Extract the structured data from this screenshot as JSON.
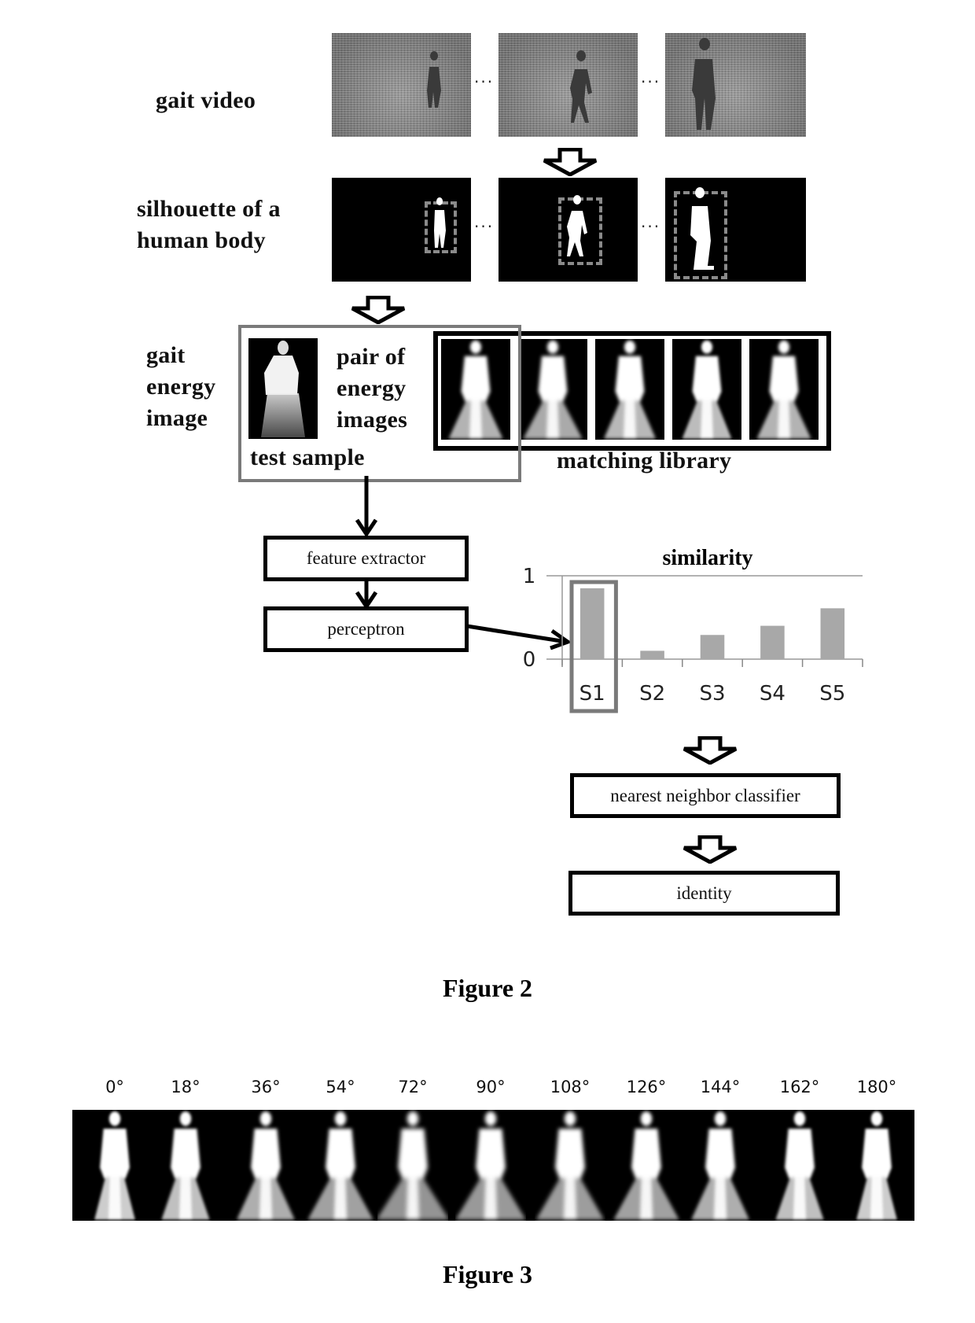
{
  "figure2": {
    "caption": "Figure 2",
    "labels": {
      "gait_video": "gait video",
      "silhouette_line1": "silhouette of a",
      "silhouette_line2": "human body",
      "gei_line1": "gait",
      "gei_line2": "energy",
      "gei_line3": "image",
      "pair_line1": "pair of",
      "pair_line2": "energy",
      "pair_line3": "images",
      "test_sample": "test sample",
      "matching_library": "matching library"
    },
    "ellipsis": "···",
    "gait_video_frames": 3,
    "silhouette_frames": 3,
    "matching_library_count": 5,
    "flow": {
      "feature_extractor": "feature extractor",
      "perceptron": "perceptron",
      "nearest_neighbor": "nearest neighbor classifier",
      "identity": "identity"
    },
    "highlight_color": "#7a7a7a",
    "bar_color": "#a8a8a8"
  },
  "chart_data": {
    "type": "bar",
    "title": "similarity",
    "categories": [
      "S1",
      "S2",
      "S3",
      "S4",
      "S5"
    ],
    "values": [
      0.85,
      0.1,
      0.29,
      0.4,
      0.61
    ],
    "xlabel": "",
    "ylabel": "",
    "ylim": [
      0,
      1
    ],
    "yticks": [
      "0",
      "1"
    ],
    "grid": true,
    "highlighted_category": "S1"
  },
  "figure3": {
    "caption": "Figure 3",
    "angles": [
      "0°",
      "18°",
      "36°",
      "54°",
      "72°",
      "90°",
      "108°",
      "126°",
      "144°",
      "162°",
      "180°"
    ]
  }
}
